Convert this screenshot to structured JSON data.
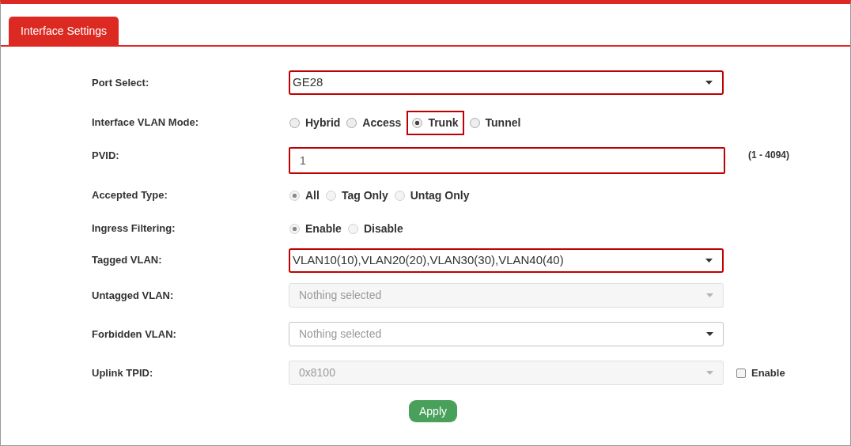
{
  "tab": {
    "label": "Interface Settings",
    "selected": true
  },
  "fields": [
    {
      "kind": "select",
      "label": "Port Select:",
      "value": "GE28",
      "highlighted": true,
      "disabled": false
    },
    {
      "kind": "radio",
      "label": "Interface VLAN Mode:",
      "disabled": false,
      "options": [
        {
          "label": "Hybrid",
          "selected": false,
          "highlighted": false
        },
        {
          "label": "Access",
          "selected": false,
          "highlighted": false
        },
        {
          "label": "Trunk",
          "selected": true,
          "highlighted": true
        },
        {
          "label": "Tunnel",
          "selected": false,
          "highlighted": false
        }
      ]
    },
    {
      "kind": "text",
      "label": "PVID:",
      "value": "1",
      "highlighted": true,
      "hint": "(1 - 4094)"
    },
    {
      "kind": "radio",
      "label": "Accepted Type:",
      "disabled": true,
      "options": [
        {
          "label": "All",
          "selected": true,
          "highlighted": false
        },
        {
          "label": "Tag Only",
          "selected": false,
          "highlighted": false
        },
        {
          "label": "Untag Only",
          "selected": false,
          "highlighted": false
        }
      ]
    },
    {
      "kind": "radio",
      "label": "Ingress Filtering:",
      "disabled": true,
      "options": [
        {
          "label": "Enable",
          "selected": true,
          "highlighted": false
        },
        {
          "label": "Disable",
          "selected": false,
          "highlighted": false
        }
      ]
    },
    {
      "kind": "select",
      "label": "Tagged VLAN:",
      "value": "VLAN10(10),VLAN20(20),VLAN30(30),VLAN40(40)",
      "highlighted": true,
      "disabled": false
    },
    {
      "kind": "select",
      "label": "Untagged VLAN:",
      "placeholder": "Nothing selected",
      "highlighted": false,
      "disabled": true
    },
    {
      "kind": "select",
      "label": "Forbidden VLAN:",
      "placeholder": "Nothing selected",
      "highlighted": false,
      "disabled": false
    },
    {
      "kind": "select",
      "label": "Uplink TPID:",
      "value": "0x8100",
      "highlighted": false,
      "disabled": true,
      "checkbox": {
        "label": "Enable",
        "checked": false
      }
    }
  ],
  "apply_button": "Apply"
}
